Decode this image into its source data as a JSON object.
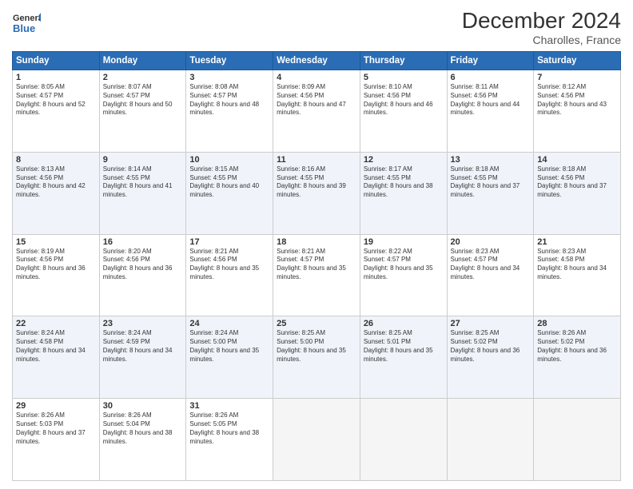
{
  "logo": {
    "line1": "General",
    "line2": "Blue"
  },
  "title": "December 2024",
  "location": "Charolles, France",
  "days_of_week": [
    "Sunday",
    "Monday",
    "Tuesday",
    "Wednesday",
    "Thursday",
    "Friday",
    "Saturday"
  ],
  "weeks": [
    [
      {
        "day": "1",
        "sunrise": "8:05 AM",
        "sunset": "4:57 PM",
        "daylight": "8 hours and 52 minutes."
      },
      {
        "day": "2",
        "sunrise": "8:07 AM",
        "sunset": "4:57 PM",
        "daylight": "8 hours and 50 minutes."
      },
      {
        "day": "3",
        "sunrise": "8:08 AM",
        "sunset": "4:57 PM",
        "daylight": "8 hours and 48 minutes."
      },
      {
        "day": "4",
        "sunrise": "8:09 AM",
        "sunset": "4:56 PM",
        "daylight": "8 hours and 47 minutes."
      },
      {
        "day": "5",
        "sunrise": "8:10 AM",
        "sunset": "4:56 PM",
        "daylight": "8 hours and 46 minutes."
      },
      {
        "day": "6",
        "sunrise": "8:11 AM",
        "sunset": "4:56 PM",
        "daylight": "8 hours and 44 minutes."
      },
      {
        "day": "7",
        "sunrise": "8:12 AM",
        "sunset": "4:56 PM",
        "daylight": "8 hours and 43 minutes."
      }
    ],
    [
      {
        "day": "8",
        "sunrise": "8:13 AM",
        "sunset": "4:56 PM",
        "daylight": "8 hours and 42 minutes."
      },
      {
        "day": "9",
        "sunrise": "8:14 AM",
        "sunset": "4:55 PM",
        "daylight": "8 hours and 41 minutes."
      },
      {
        "day": "10",
        "sunrise": "8:15 AM",
        "sunset": "4:55 PM",
        "daylight": "8 hours and 40 minutes."
      },
      {
        "day": "11",
        "sunrise": "8:16 AM",
        "sunset": "4:55 PM",
        "daylight": "8 hours and 39 minutes."
      },
      {
        "day": "12",
        "sunrise": "8:17 AM",
        "sunset": "4:55 PM",
        "daylight": "8 hours and 38 minutes."
      },
      {
        "day": "13",
        "sunrise": "8:18 AM",
        "sunset": "4:55 PM",
        "daylight": "8 hours and 37 minutes."
      },
      {
        "day": "14",
        "sunrise": "8:18 AM",
        "sunset": "4:56 PM",
        "daylight": "8 hours and 37 minutes."
      }
    ],
    [
      {
        "day": "15",
        "sunrise": "8:19 AM",
        "sunset": "4:56 PM",
        "daylight": "8 hours and 36 minutes."
      },
      {
        "day": "16",
        "sunrise": "8:20 AM",
        "sunset": "4:56 PM",
        "daylight": "8 hours and 36 minutes."
      },
      {
        "day": "17",
        "sunrise": "8:21 AM",
        "sunset": "4:56 PM",
        "daylight": "8 hours and 35 minutes."
      },
      {
        "day": "18",
        "sunrise": "8:21 AM",
        "sunset": "4:57 PM",
        "daylight": "8 hours and 35 minutes."
      },
      {
        "day": "19",
        "sunrise": "8:22 AM",
        "sunset": "4:57 PM",
        "daylight": "8 hours and 35 minutes."
      },
      {
        "day": "20",
        "sunrise": "8:23 AM",
        "sunset": "4:57 PM",
        "daylight": "8 hours and 34 minutes."
      },
      {
        "day": "21",
        "sunrise": "8:23 AM",
        "sunset": "4:58 PM",
        "daylight": "8 hours and 34 minutes."
      }
    ],
    [
      {
        "day": "22",
        "sunrise": "8:24 AM",
        "sunset": "4:58 PM",
        "daylight": "8 hours and 34 minutes."
      },
      {
        "day": "23",
        "sunrise": "8:24 AM",
        "sunset": "4:59 PM",
        "daylight": "8 hours and 34 minutes."
      },
      {
        "day": "24",
        "sunrise": "8:24 AM",
        "sunset": "5:00 PM",
        "daylight": "8 hours and 35 minutes."
      },
      {
        "day": "25",
        "sunrise": "8:25 AM",
        "sunset": "5:00 PM",
        "daylight": "8 hours and 35 minutes."
      },
      {
        "day": "26",
        "sunrise": "8:25 AM",
        "sunset": "5:01 PM",
        "daylight": "8 hours and 35 minutes."
      },
      {
        "day": "27",
        "sunrise": "8:25 AM",
        "sunset": "5:02 PM",
        "daylight": "8 hours and 36 minutes."
      },
      {
        "day": "28",
        "sunrise": "8:26 AM",
        "sunset": "5:02 PM",
        "daylight": "8 hours and 36 minutes."
      }
    ],
    [
      {
        "day": "29",
        "sunrise": "8:26 AM",
        "sunset": "5:03 PM",
        "daylight": "8 hours and 37 minutes."
      },
      {
        "day": "30",
        "sunrise": "8:26 AM",
        "sunset": "5:04 PM",
        "daylight": "8 hours and 38 minutes."
      },
      {
        "day": "31",
        "sunrise": "8:26 AM",
        "sunset": "5:05 PM",
        "daylight": "8 hours and 38 minutes."
      },
      null,
      null,
      null,
      null
    ]
  ]
}
